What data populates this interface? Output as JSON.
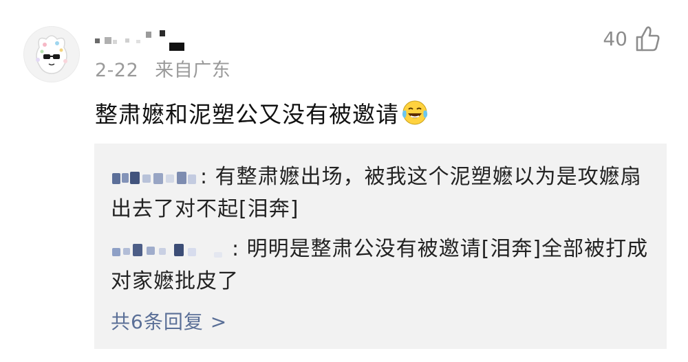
{
  "comment": {
    "date": "2-22",
    "location": "来自广东",
    "likes": "40",
    "text": "整肃嬷和泥塑公又没有被邀请",
    "emoji": "laughing-crying-emoji"
  },
  "replies": [
    {
      "separator": ": ",
      "text": "有整肃嬷出场，被我这个泥塑嬷以为是攻嬷扇出去了对不起[泪奔]"
    },
    {
      "separator": ": ",
      "text": "明明是整肃公没有被邀请[泪奔]全部被打成对家嬷批皮了"
    }
  ],
  "more_replies": "共6条回复 >",
  "colors": {
    "meta": "#9a9a9a",
    "reply_bg": "#f2f2f2",
    "link": "#5a6f97"
  }
}
